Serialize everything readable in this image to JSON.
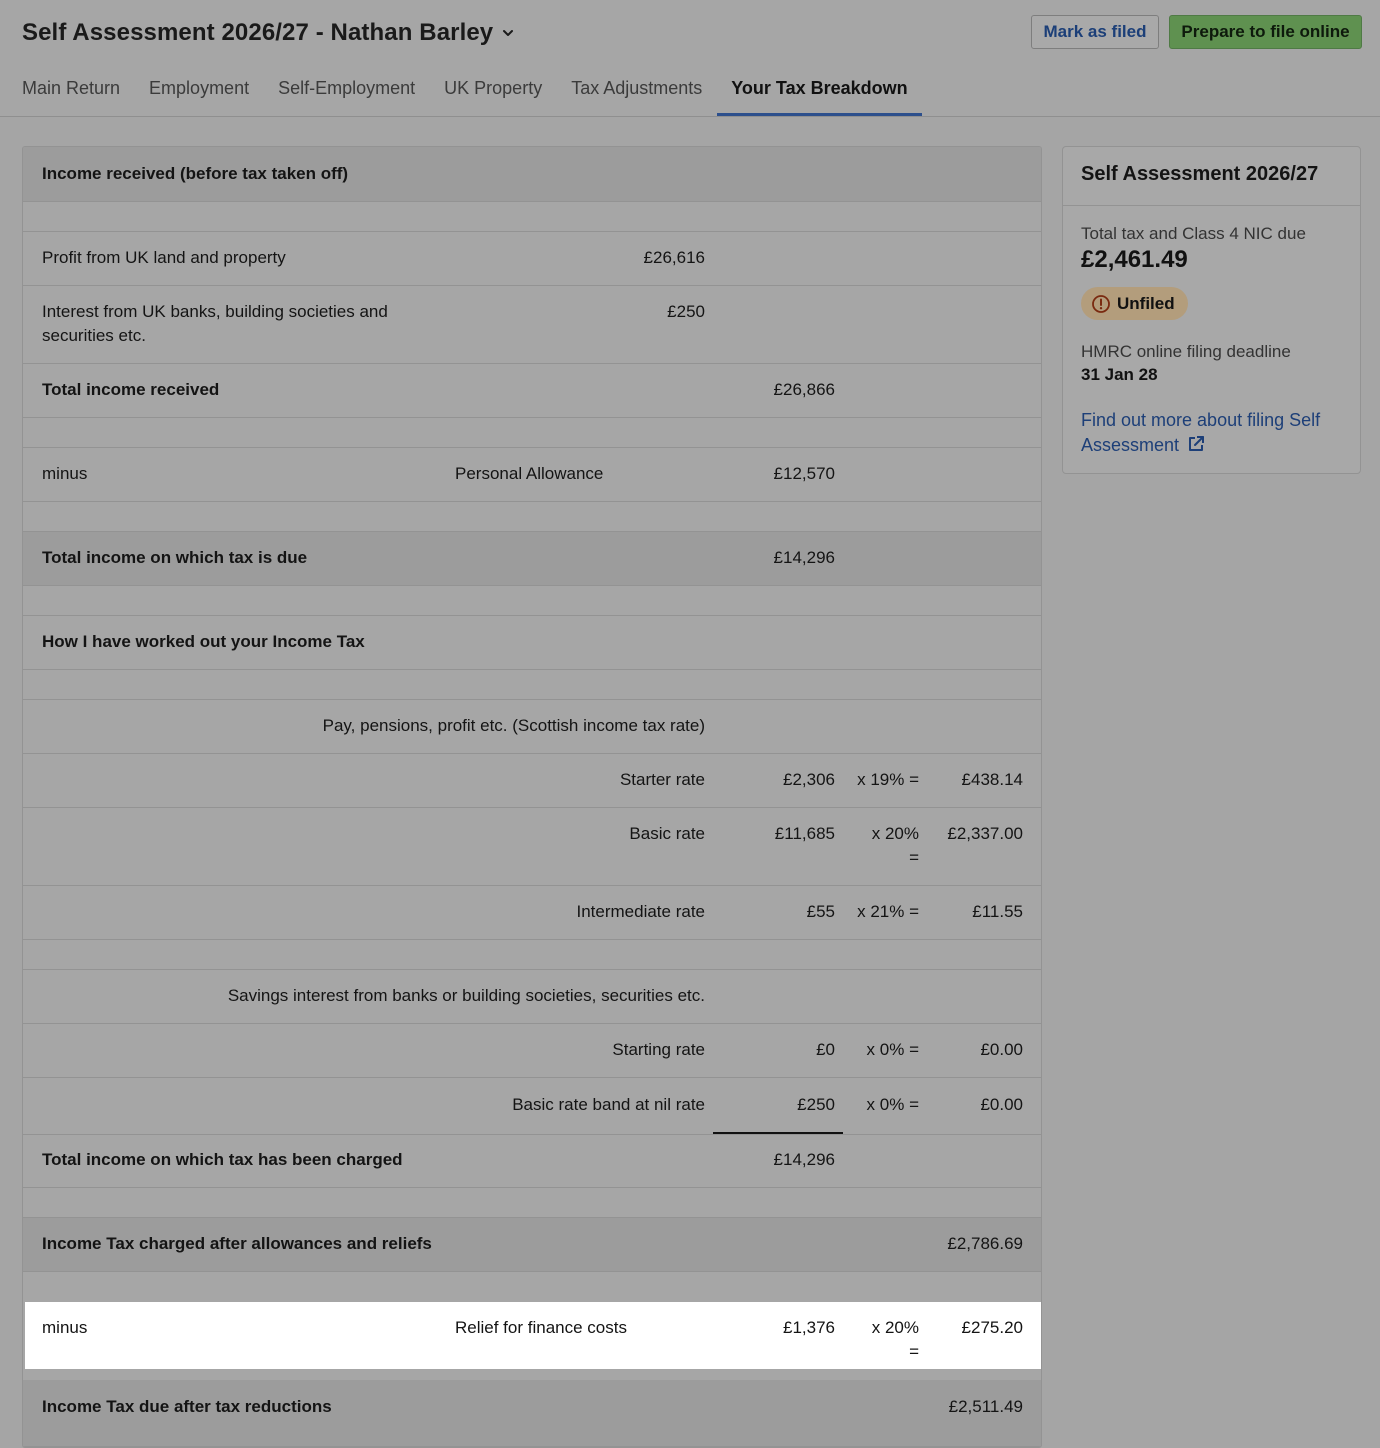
{
  "header": {
    "title": "Self Assessment 2026/27 - Nathan Barley",
    "mark_filed": "Mark as filed",
    "prepare": "Prepare to file online"
  },
  "tabs": [
    {
      "label": "Main Return"
    },
    {
      "label": "Employment"
    },
    {
      "label": "Self-Employment"
    },
    {
      "label": "UK Property"
    },
    {
      "label": "Tax Adjustments"
    },
    {
      "label": "Your Tax Breakdown",
      "active": true
    }
  ],
  "breakdown": {
    "income_heading": "Income received (before tax taken off)",
    "property_label": "Profit from UK land and property",
    "property_value": "£26,616",
    "interest_label_1": "Interest from UK banks, building societies and",
    "interest_label_2": "securities etc.",
    "interest_value": "£250",
    "total_income_label": "Total income received",
    "total_income_value": "£26,866",
    "minus_label": "minus",
    "allowance_label": "Personal Allowance",
    "allowance_value": "£12,570",
    "taxable_label": "Total income on which tax is due",
    "taxable_value": "£14,296",
    "workings_heading": "How I have worked out your Income Tax",
    "pay_heading": "Pay, pensions, profit etc. (Scottish income tax rate)",
    "starter": {
      "label": "Starter rate",
      "amount": "£2,306",
      "mult": "x 19% =",
      "result": "£438.14"
    },
    "basic": {
      "label": "Basic rate",
      "amount": "£11,685",
      "mult1": "x 20%",
      "mult2": "=",
      "result": "£2,337.00"
    },
    "intermediate": {
      "label": "Intermediate rate",
      "amount": "£55",
      "mult": "x 21% =",
      "result": "£11.55"
    },
    "savings_heading": "Savings interest from banks or building societies, securities etc.",
    "starting": {
      "label": "Starting rate",
      "amount": "£0",
      "mult": "x 0% =",
      "result": "£0.00"
    },
    "nil_band": {
      "label": "Basic rate band at nil rate",
      "amount": "£250",
      "mult": "x 0% =",
      "result": "£0.00"
    },
    "charged_label": "Total income on which tax has been charged",
    "charged_value": "£14,296",
    "after_allowances_label": "Income Tax charged after allowances and reliefs",
    "after_allowances_value": "£2,786.69",
    "relief": {
      "minus": "minus",
      "label": "Relief for finance costs",
      "amount": "£1,376",
      "mult1": "x 20%",
      "mult2": "=",
      "result": "£275.20"
    },
    "due_label": "Income Tax due after tax reductions",
    "due_value": "£2,511.49"
  },
  "sidebar": {
    "title": "Self Assessment 2026/27",
    "total_label": "Total tax and Class 4 NIC due",
    "total_value": "£2,461.49",
    "status": "Unfiled",
    "deadline_label": "HMRC online filing deadline",
    "deadline_value": "31 Jan 28",
    "link_1": "Find out more about filing Self",
    "link_2": "Assessment"
  },
  "colors": {
    "accent": "#2c4f8c",
    "primary_button": "#5f9150",
    "link": "#1d3f78",
    "badge": "#b39d7c"
  },
  "icons": {
    "title_dropdown": "chevron-down-icon",
    "status": "alert-circle-icon",
    "link": "external-link-icon"
  }
}
